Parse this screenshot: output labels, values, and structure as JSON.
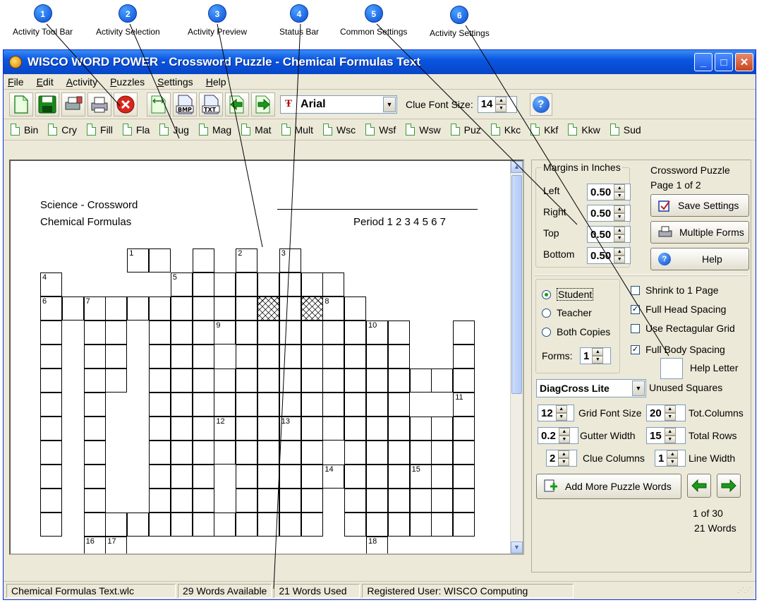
{
  "callouts": [
    {
      "num": "1",
      "label": "Activity Tool Bar"
    },
    {
      "num": "2",
      "label": "Activity Selection"
    },
    {
      "num": "3",
      "label": "Activity Preview"
    },
    {
      "num": "4",
      "label": "Status Bar"
    },
    {
      "num": "5",
      "label": "Common Settings"
    },
    {
      "num": "6",
      "label": "Activity Settings"
    }
  ],
  "window": {
    "title": "WISCO WORD POWER - Crossword Puzzle - Chemical Formulas Text",
    "minimize": "_",
    "maximize": "□",
    "close": "✕"
  },
  "menu": [
    "File",
    "Edit",
    "Activity",
    "Puzzles",
    "Settings",
    "Help"
  ],
  "toolbar": {
    "font_glyph": "Ŧ",
    "font_name": "Arial",
    "clue_font_label": "Clue Font Size:",
    "clue_font_size": "14",
    "icons": [
      "new-doc-icon",
      "save-icon",
      "print-setup-icon",
      "print-icon",
      "cancel-icon",
      "fit-icon",
      "bmp-icon",
      "txt-icon",
      "prev-icon",
      "next-icon"
    ]
  },
  "activities": [
    "Bin",
    "Cry",
    "Fill",
    "Fla",
    "Jug",
    "Mag",
    "Mat",
    "Mult",
    "Wsc",
    "Wsf",
    "Wsw",
    "Puz",
    "Kkc",
    "Kkf",
    "Kkw",
    "Sud"
  ],
  "preview": {
    "heading_line1": "Science - Crossword",
    "heading_line2": "Chemical Formulas",
    "period_label": "Period  1  2  3  4  5  6  7",
    "numbers": [
      "1",
      "2",
      "3",
      "4",
      "5",
      "6",
      "7",
      "8",
      "9",
      "10",
      "11",
      "12",
      "13",
      "14",
      "15",
      "16",
      "17",
      "18"
    ]
  },
  "margins": {
    "legend": "Margins in Inches",
    "left_label": "Left",
    "left": "0.50",
    "right_label": "Right",
    "right": "0.50",
    "top_label": "Top",
    "top": "0.50",
    "bottom_label": "Bottom",
    "bottom": "0.50"
  },
  "common": {
    "title": "Crossword Puzzle",
    "page": "Page 1 of 2",
    "save_settings": "Save Settings",
    "multiple_forms": "Multiple Forms",
    "help": "Help"
  },
  "settings": {
    "copies": [
      "Student",
      "Teacher",
      "Both Copies"
    ],
    "selected_copy": "Student",
    "forms_label": "Forms:",
    "forms": "1",
    "options": [
      {
        "label": "Shrink to 1 Page",
        "checked": ""
      },
      {
        "label": "Full Head Spacing",
        "checked": "✓"
      },
      {
        "label": "Use Rectagular Grid",
        "checked": ""
      },
      {
        "label": "Full Body Spacing",
        "checked": "✓"
      }
    ],
    "help_letter_label": "Help Letter",
    "unused_style": "DiagCross Lite",
    "unused_label": "Unused Squares",
    "grid_font_size": "12",
    "grid_font_label": "Grid Font Size",
    "tot_columns": "20",
    "tot_columns_label": "Tot.Columns",
    "gutter_width": "0.2",
    "gutter_label": "Gutter Width",
    "total_rows": "15",
    "total_rows_label": "Total Rows",
    "clue_columns": "2",
    "clue_columns_label": "Clue Columns",
    "line_width": "1",
    "line_width_label": "Line Width",
    "add_words": "Add More Puzzle Words",
    "word_position": "1 of 30",
    "word_count": "21 Words"
  },
  "status": {
    "file": "Chemical Formulas Text.wlc",
    "available": "29 Words Available",
    "used": "21 Words Used",
    "user": "Registered User:  WISCO Computing"
  },
  "colors": {
    "accent": "#0a56e0",
    "face": "#ece9d8"
  }
}
